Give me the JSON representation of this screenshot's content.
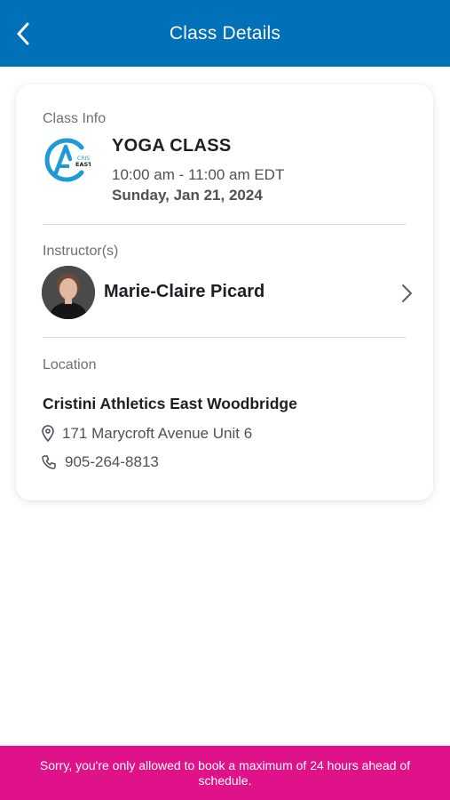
{
  "header": {
    "title": "Class Details",
    "back_icon": "chevron-left-icon",
    "background": "#0070b8"
  },
  "class_info": {
    "label": "Class Info",
    "logo_text_top": "CRIS",
    "logo_text_bottom": "EAST",
    "name": "YOGA CLASS",
    "time": "10:00 am - 11:00 am EDT",
    "date": "Sunday, Jan 21, 2024"
  },
  "instructors": {
    "label": "Instructor(s)",
    "items": [
      {
        "name": "Marie-Claire Picard",
        "icon": "chevron-right-icon"
      }
    ]
  },
  "location": {
    "label": "Location",
    "name": "Cristini Athletics East Woodbridge",
    "address": "171 Marycroft Avenue Unit 6",
    "address_icon": "map-pin-icon",
    "phone": "905-264-8813",
    "phone_icon": "phone-icon"
  },
  "banner": {
    "message": "Sorry, you're only allowed to book a maximum of 24 hours ahead of schedule.",
    "background": "#e0128a"
  }
}
